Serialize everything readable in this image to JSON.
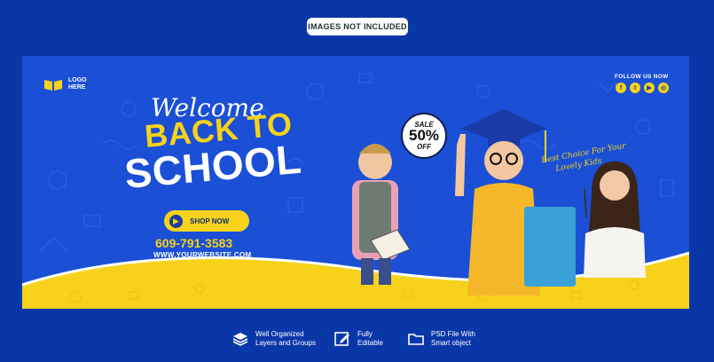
{
  "top_tag": "IMAGES NOT INCLUDED",
  "logo": {
    "line1": "LOGO",
    "line2": "HERE",
    "icon": "open-book-icon"
  },
  "headline": {
    "welcome": "Welcome",
    "back_to": "BACK TO",
    "school": "SCHOOL"
  },
  "shop_button": {
    "label": "SHOP NOW",
    "icon": "arrow-right-icon"
  },
  "contact": {
    "phone": "609-791-3583",
    "website": "WWW.YOURWEBSITE.COM"
  },
  "social": {
    "label": "FOLLOW US NOW",
    "icons": [
      "facebook-icon",
      "twitter-icon",
      "youtube-icon",
      "instagram-icon"
    ]
  },
  "sale_badge": {
    "top": "SALE",
    "value": "50%",
    "bottom": "OFF"
  },
  "tagline": {
    "line1": "Best Choice For Your",
    "line2": "Lovely Kids"
  },
  "footer": [
    {
      "icon": "layers-icon",
      "line1": "Well Organized",
      "line2": "Layers and Groups"
    },
    {
      "icon": "edit-icon",
      "line1": "Fully",
      "line2": "Editable"
    },
    {
      "icon": "folder-icon",
      "line1": "PSD File With",
      "line2": "Smart object"
    }
  ],
  "colors": {
    "background": "#0a37a8",
    "banner": "#1a4fd6",
    "accent_yellow": "#f6d21a",
    "text_white": "#ffffff"
  }
}
